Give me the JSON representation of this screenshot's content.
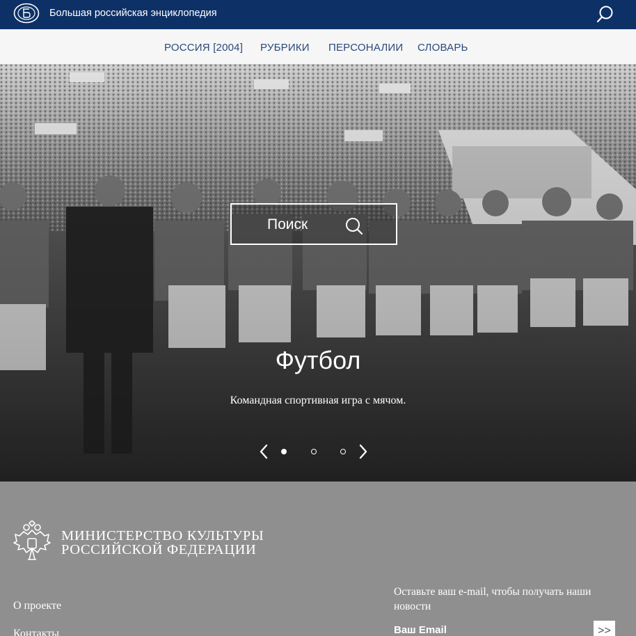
{
  "header": {
    "site_title": "Большая российская энциклопедия"
  },
  "nav": {
    "items": [
      {
        "label": "РОССИЯ [2004]"
      },
      {
        "label": "РУБРИКИ"
      },
      {
        "label": "ПЕРСОНАЛИИ"
      },
      {
        "label": "СЛОВАРЬ"
      }
    ]
  },
  "hero": {
    "search_label": "Поиск",
    "title": "Футбол",
    "subtitle": "Командная спортивная игра с мячом.",
    "slides_total": 3,
    "active_slide": 1
  },
  "footer": {
    "ministry_line1": "МИНИСТЕРСТВО КУЛЬТУРЫ",
    "ministry_line2": "РОССИЙСКОЙ ФЕДЕРАЦИИ",
    "links": [
      {
        "label": "О проекте"
      },
      {
        "label": "Контакты"
      }
    ],
    "subscribe_text": "Оставьте ваш e-mail, чтобы получать наши новости",
    "email_placeholder": "Ваш Email",
    "submit_label": ">>"
  },
  "colors": {
    "header_bg": "#0d3166",
    "nav_bg": "#f6f6f6",
    "nav_text": "#284a7a",
    "footer_bg": "#8f8f8f"
  }
}
